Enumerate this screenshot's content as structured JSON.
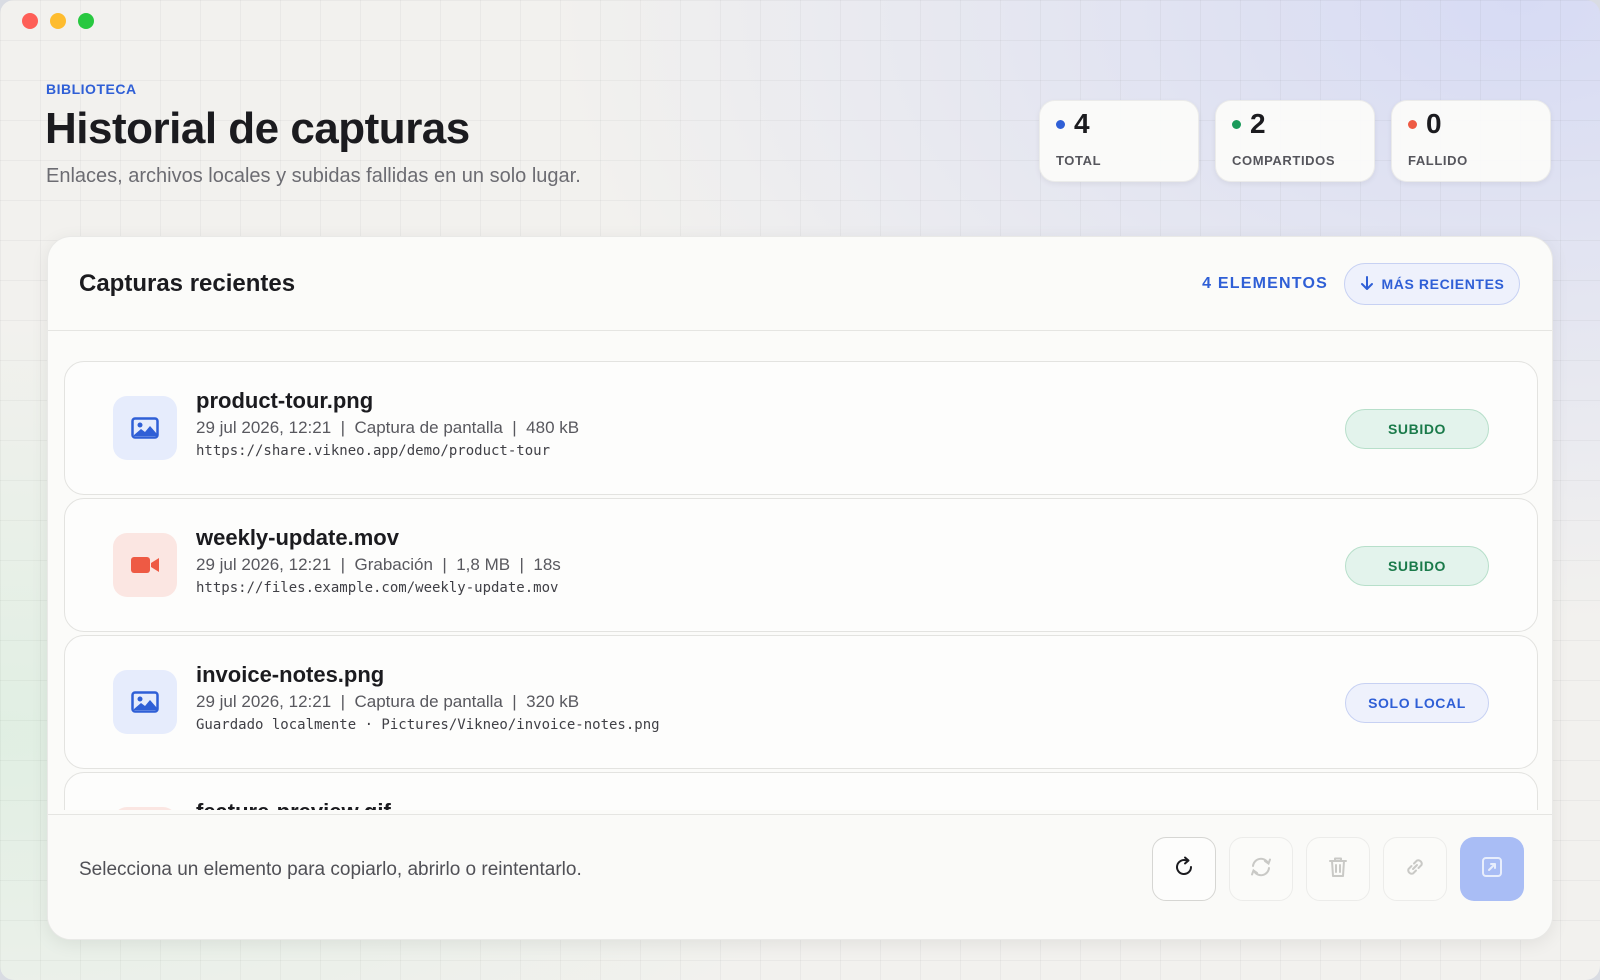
{
  "header": {
    "eyebrow": "BIBLIOTECA",
    "title": "Historial de capturas",
    "subtitle": "Enlaces, archivos locales y subidas fallidas en un solo lugar."
  },
  "stats": [
    {
      "value": "4",
      "label": "TOTAL",
      "dot_color": "#2f5fd6"
    },
    {
      "value": "2",
      "label": "COMPARTIDOS",
      "dot_color": "#1a9a5a"
    },
    {
      "value": "0",
      "label": "FALLIDO",
      "dot_color": "#ee5a44"
    }
  ],
  "panel": {
    "title": "Capturas recientes",
    "count_label": "4 ELEMENTOS",
    "sort_label": "MÁS RECIENTES",
    "sort_icon": "arrow-down-icon"
  },
  "items": [
    {
      "name": "product-tour.png",
      "meta": "29 jul 2026, 12:21  |  Captura de pantalla  |  480 kB",
      "link": "https://share.vikneo.app/demo/product-tour",
      "badge": "SUBIDO",
      "kind": "image",
      "icon": "image-icon"
    },
    {
      "name": "weekly-update.mov",
      "meta": "29 jul 2026, 12:21  |  Grabación  |  1,8 MB  |  18s",
      "link": "https://files.example.com/weekly-update.mov",
      "badge": "SUBIDO",
      "kind": "video",
      "icon": "video-camera-icon"
    },
    {
      "name": "invoice-notes.png",
      "meta": "29 jul 2026, 12:21  |  Captura de pantalla  |  320 kB",
      "link": "Guardado localmente · Pictures/Vikneo/invoice-notes.png",
      "badge": "SOLO LOCAL",
      "kind": "image",
      "icon": "image-icon"
    },
    {
      "name": "feature-preview.gif",
      "kind": "video"
    }
  ],
  "footer": {
    "hint": "Selecciona un elemento para copiarlo, abrirlo o reintentarlo.",
    "actions": [
      "refresh-icon",
      "retry-icon",
      "trash-icon",
      "link-icon",
      "open-external-icon"
    ]
  },
  "colors": {
    "accent": "#2f5fd6",
    "success": "#1a7a4a",
    "video": "#ee5a44",
    "primary_disabled": "#a9bdf5"
  }
}
